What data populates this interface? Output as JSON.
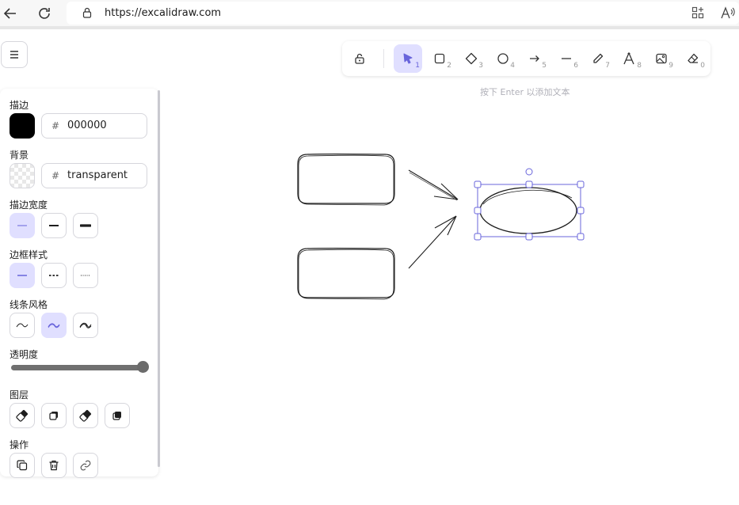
{
  "browser": {
    "url": "https://excalidraw.com",
    "icons": [
      "back-arrow-icon",
      "reload-icon",
      "lock-icon",
      "add-tab-icon",
      "read-aloud-icon"
    ]
  },
  "menu": {
    "icon": "hamburger-icon"
  },
  "toolbar": {
    "tools": [
      {
        "id": "lock",
        "icon": "unlock-icon",
        "key": ""
      },
      {
        "id": "selection",
        "icon": "pointer-icon",
        "key": "1",
        "active": true
      },
      {
        "id": "rectangle",
        "icon": "square-icon",
        "key": "2"
      },
      {
        "id": "diamond",
        "icon": "diamond-icon",
        "key": "3"
      },
      {
        "id": "ellipse",
        "icon": "circle-icon",
        "key": "4"
      },
      {
        "id": "arrow",
        "icon": "arrow-icon",
        "key": "5"
      },
      {
        "id": "line",
        "icon": "line-icon",
        "key": "6"
      },
      {
        "id": "draw",
        "icon": "pencil-icon",
        "key": "7"
      },
      {
        "id": "text",
        "icon": "text-icon",
        "key": "8"
      },
      {
        "id": "image",
        "icon": "image-icon",
        "key": "9"
      },
      {
        "id": "eraser",
        "icon": "eraser-icon",
        "key": "0"
      }
    ]
  },
  "hint": "按下 Enter 以添加文本",
  "panel": {
    "stroke_label": "描边",
    "stroke_hash": "#",
    "stroke_value": "000000",
    "background_label": "背景",
    "background_hash": "#",
    "background_value": "transparent",
    "stroke_width_label": "描边宽度",
    "stroke_style_label": "边框样式",
    "sloppiness_label": "线条风格",
    "opacity_label": "透明度",
    "opacity_value": 1.0,
    "layers_label": "图层",
    "actions_label": "操作"
  },
  "colors": {
    "accent": "#6965db",
    "accent_light": "#e0dfff",
    "selection": "#6965db",
    "stroke": "#000000"
  }
}
